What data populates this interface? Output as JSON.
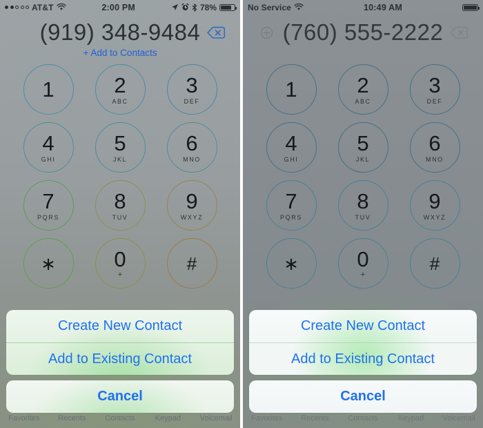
{
  "panels": [
    {
      "id": "left",
      "statusbar": {
        "signal_dots_filled": 2,
        "signal_dots_total": 5,
        "carrier": "AT&T",
        "wifi_icon": "wifi-icon",
        "time": "2:00 PM",
        "location_icon": "location-arrow-icon",
        "alarm_icon": "alarm-clock-icon",
        "bluetooth_icon": "bluetooth-icon",
        "battery_percent": "78%",
        "battery_level": 78
      },
      "number_display": {
        "phone_number": "(919) 348-9484",
        "show_plus_icon": false,
        "plus_icon": "circled-plus-icon",
        "delete_icon": "backspace-delete-icon",
        "delete_icon_color": "#2f6bbf"
      },
      "add_to_contacts_label": "+ Add to Contacts",
      "add_to_contacts_color": "#1f60d8",
      "keypad": [
        {
          "digit": "1",
          "letters": "",
          "ring": "c1"
        },
        {
          "digit": "2",
          "letters": "ABC",
          "ring": "c2"
        },
        {
          "digit": "3",
          "letters": "DEF",
          "ring": "c3"
        },
        {
          "digit": "4",
          "letters": "GHI",
          "ring": "c4"
        },
        {
          "digit": "5",
          "letters": "JKL",
          "ring": "c5"
        },
        {
          "digit": "6",
          "letters": "MNO",
          "ring": "c6"
        },
        {
          "digit": "7",
          "letters": "PQRS",
          "ring": "c7"
        },
        {
          "digit": "8",
          "letters": "TUV",
          "ring": "c8"
        },
        {
          "digit": "9",
          "letters": "WXYZ",
          "ring": "c9"
        },
        {
          "digit": "∗",
          "letters": "",
          "ring": "cs"
        },
        {
          "digit": "0",
          "letters": "+",
          "ring": "c0"
        },
        {
          "digit": "#",
          "letters": "",
          "ring": "ch"
        }
      ],
      "action_sheet": {
        "options": [
          "Create New Contact",
          "Add to Existing Contact"
        ],
        "cancel": "Cancel",
        "tint": "#2070f0"
      },
      "tabbar": [
        "Favorites",
        "Recents",
        "Contacts",
        "Keypad",
        "Voicemail"
      ]
    },
    {
      "id": "right",
      "statusbar": {
        "signal_dots_filled": 0,
        "signal_dots_total": 0,
        "carrier": "No Service",
        "wifi_icon": "wifi-icon",
        "time": "10:49 AM",
        "location_icon": "",
        "alarm_icon": "",
        "bluetooth_icon": "",
        "battery_percent": "",
        "battery_level": 100
      },
      "number_display": {
        "phone_number": "(760) 555-2222",
        "show_plus_icon": true,
        "plus_icon": "circled-plus-icon",
        "delete_icon": "backspace-delete-icon",
        "delete_icon_color": "#7d8487"
      },
      "add_to_contacts_label": "",
      "add_to_contacts_color": "#1f60d8",
      "keypad": [
        {
          "digit": "1",
          "letters": "",
          "ring": "r1"
        },
        {
          "digit": "2",
          "letters": "ABC",
          "ring": "r2"
        },
        {
          "digit": "3",
          "letters": "DEF",
          "ring": "r3"
        },
        {
          "digit": "4",
          "letters": "GHI",
          "ring": "r4"
        },
        {
          "digit": "5",
          "letters": "JKL",
          "ring": "r5"
        },
        {
          "digit": "6",
          "letters": "MNO",
          "ring": "r6"
        },
        {
          "digit": "7",
          "letters": "PQRS",
          "ring": "r7"
        },
        {
          "digit": "8",
          "letters": "TUV",
          "ring": "r8"
        },
        {
          "digit": "9",
          "letters": "WXYZ",
          "ring": "r9"
        },
        {
          "digit": "∗",
          "letters": "",
          "ring": "rs"
        },
        {
          "digit": "0",
          "letters": "+",
          "ring": "r0"
        },
        {
          "digit": "#",
          "letters": "",
          "ring": "rh"
        }
      ],
      "action_sheet": {
        "options": [
          "Create New Contact",
          "Add to Existing Contact"
        ],
        "cancel": "Cancel",
        "tint": "#2070f0"
      },
      "tabbar": [
        "Favorites",
        "Recents",
        "Contacts",
        "Keypad",
        "Voicemail"
      ]
    }
  ]
}
